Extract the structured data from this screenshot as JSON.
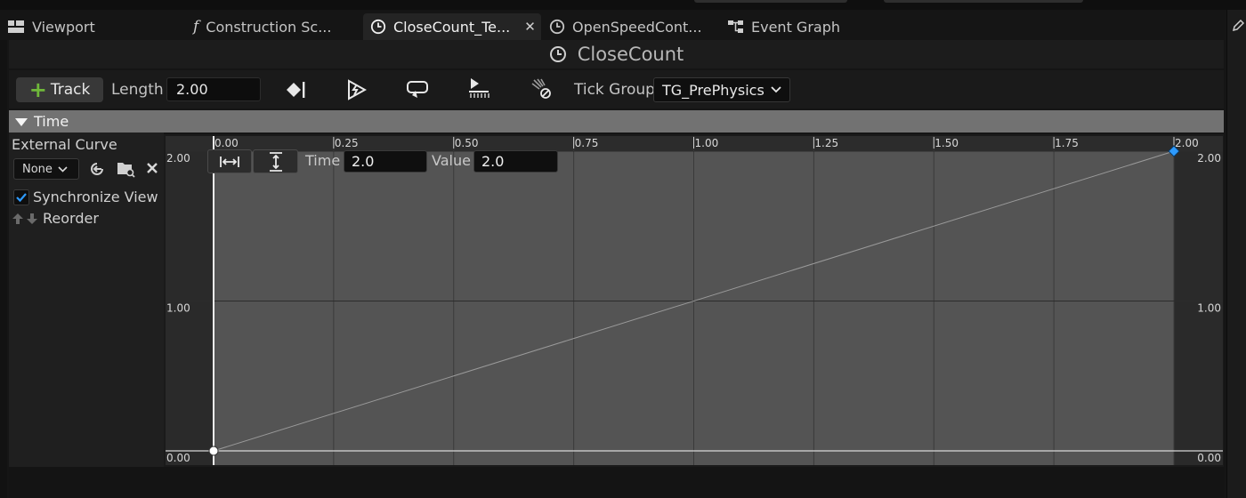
{
  "tabs": [
    {
      "label": "Viewport",
      "icon": "viewport-icon",
      "active": false
    },
    {
      "label": "Construction Sc...",
      "icon": "function-icon",
      "active": false
    },
    {
      "label": "CloseCount_Te...",
      "icon": "timeline-clock-icon",
      "active": true
    },
    {
      "label": "OpenSpeedCont...",
      "icon": "timeline-clock-icon",
      "active": false
    },
    {
      "label": "Event Graph",
      "icon": "graph-icon",
      "active": false
    }
  ],
  "title": {
    "text": "CloseCount",
    "icon": "timeline-clock-icon"
  },
  "toolbar": {
    "track_label": "Track",
    "length_label": "Length",
    "length_value": "2.00",
    "tick_group_label": "Tick Group",
    "tick_group_value": "TG_PrePhysics",
    "icons": [
      "use-last-keyframe-icon",
      "autoplay-icon",
      "loop-icon",
      "replicated-icon",
      "ignore-time-dilation-icon"
    ]
  },
  "track": {
    "name": "Time",
    "external_curve_label": "External Curve",
    "external_curve_value": "None",
    "sync_view_label": "Synchronize View",
    "sync_view_checked": true,
    "reorder_label": "Reorder"
  },
  "graph": {
    "time_label": "Time",
    "time_value": "2.0",
    "value_label": "Value",
    "value_value": "2.0",
    "x_ticks": [
      "0.00",
      "0.25",
      "0.50",
      "0.75",
      "1.00",
      "1.25",
      "1.50",
      "1.75",
      "2.00"
    ],
    "y_ticks_left": [
      "2.00",
      "1.00",
      "0.00"
    ],
    "y_ticks_right": [
      "2.00",
      "1.00",
      "0.00"
    ],
    "keys": [
      {
        "time": 0.0,
        "value": 0.0,
        "selected": false
      },
      {
        "time": 2.0,
        "value": 2.0,
        "selected": true
      }
    ],
    "colors": {
      "curve": "#9a9a9a",
      "selected_key": "#2e9bff",
      "key": "#ffffff",
      "accent": "#6fb83a"
    }
  }
}
